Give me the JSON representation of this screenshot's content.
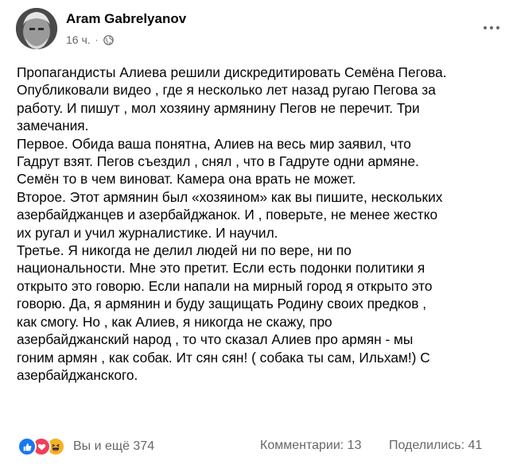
{
  "post": {
    "author": "Aram Gabrelyanov",
    "timestamp": "16 ч.",
    "separator": "·",
    "audience_icon": "globe-icon",
    "more_icon": "more-dots-icon",
    "text_lines": [
      "Пропагандисты Алиева решили дискредитировать Семёна Пегова.",
      "Опубликовали видео , где я несколько лет назад ругаю Пегова за",
      "работу. И пишут , мол хозяину армянину Пегов не перечит. Три",
      "замечания.",
      "Первое. Обида ваша понятна, Алиев на весь мир заявил, что",
      "Гадрут взят. Пегов съездил , снял , что в Гадруте одни армяне.",
      "Семён то в чем виноват. Камера она врать не может.",
      "Второе. Этот армянин был «хозяином» как вы пишите, нескольких",
      "азербайджанцев и азербайджанок. И , поверьте, не менее жестко",
      "их ругал и учил журналистике. И научил.",
      "Третье. Я никогда не делил людей ни по вере, ни по",
      "национальности. Мне это претит. Если есть подонки политики я",
      "открыто это говорю. Если напали на мирный город я открыто это",
      "говорю. Да, я армянин и буду защищать Родину своих предков ,",
      "как смогу. Но , как Алиев, я никогда не скажу, про",
      "азербайджанский  народ , то что сказал Алиев про армян - мы",
      "гоним армян , как собак. Ит сян сян! ( собака ты сам, Ильхам!) С",
      "азербайджанского."
    ]
  },
  "footer": {
    "reaction_icons": [
      "like-icon",
      "love-icon",
      "haha-icon"
    ],
    "reactions_label": "Вы и ещё 374",
    "comments_label": "Комментарии: 13",
    "shares_label": "Поделились: 41"
  },
  "colors": {
    "text": "#050505",
    "secondary": "#65676b",
    "like": "#1877f2",
    "love": "#f33e58",
    "haha": "#f7b125"
  }
}
